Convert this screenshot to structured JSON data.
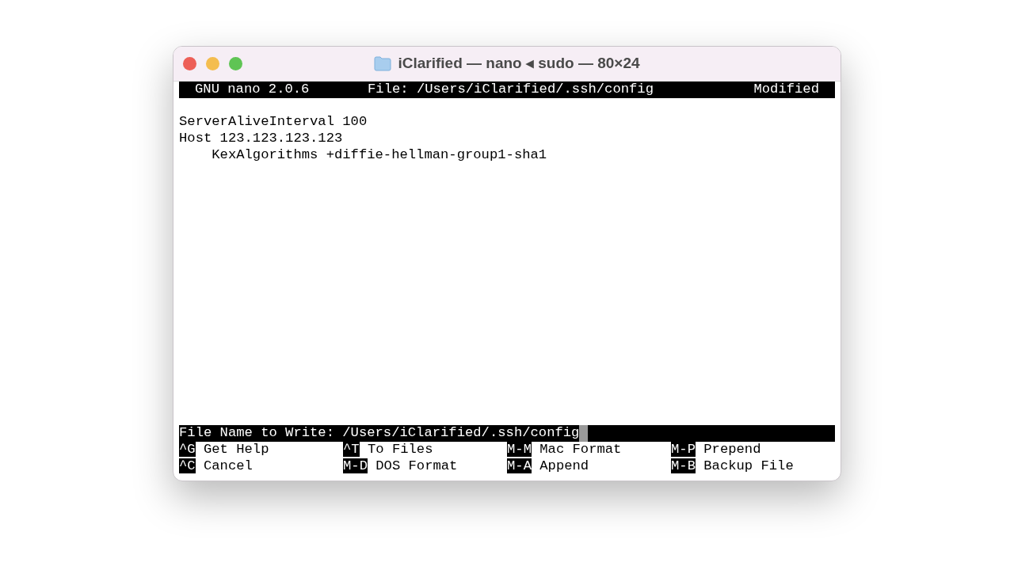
{
  "window": {
    "title": "iClarified — nano ◂ sudo — 80×24"
  },
  "header": {
    "app": "GNU nano 2.0.6",
    "file": "File: /Users/iClarified/.ssh/config",
    "status": "Modified"
  },
  "lines": [
    "ServerAliveInterval 100",
    "Host 123.123.123.123",
    "    KexAlgorithms +diffie-hellman-group1-sha1"
  ],
  "prompt": {
    "label": "File Name to Write:",
    "value": "/Users/iClarified/.ssh/config"
  },
  "shortcuts": [
    {
      "key": "^G",
      "label": "Get Help"
    },
    {
      "key": "^T",
      "label": "To Files"
    },
    {
      "key": "M-M",
      "label": "Mac Format"
    },
    {
      "key": "M-P",
      "label": "Prepend"
    },
    {
      "key": "^C",
      "label": "Cancel"
    },
    {
      "key": "M-D",
      "label": "DOS Format"
    },
    {
      "key": "M-A",
      "label": "Append"
    },
    {
      "key": "M-B",
      "label": "Backup File"
    }
  ]
}
